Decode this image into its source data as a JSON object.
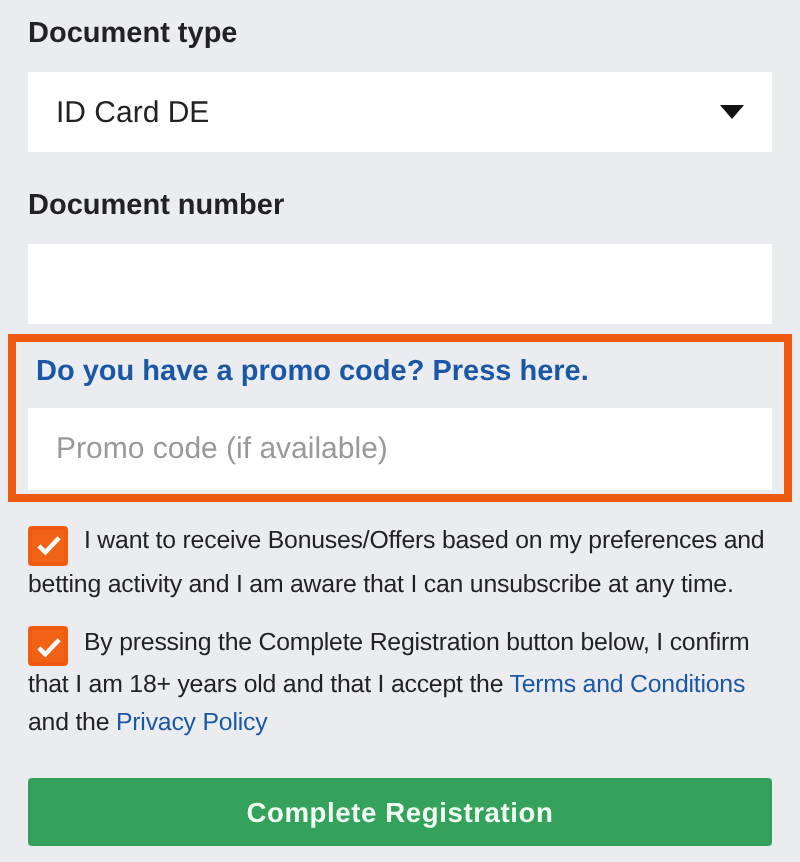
{
  "fields": [
    {
      "kind": "select",
      "label": "Document type",
      "value": "ID Card DE"
    },
    {
      "kind": "input",
      "label": "Document number"
    }
  ],
  "promo": {
    "link": "Do you have a promo code? Press here.",
    "placeholder": "Promo code (if available)",
    "highlighted": true
  },
  "consents": [
    {
      "checked": true,
      "parts": [
        {
          "kind": "text",
          "text": "I want to receive Bonuses/Offers based on my preferences and betting activity and I am aware that I can unsubscribe at any time."
        }
      ]
    },
    {
      "checked": true,
      "parts": [
        {
          "kind": "text",
          "text": "By pressing the Complete Registration button below, I confirm that I am 18+ years old and that I accept the "
        },
        {
          "kind": "link",
          "text": "Terms and Conditions"
        },
        {
          "kind": "text",
          "text": " and the "
        },
        {
          "kind": "link",
          "text": "Privacy Policy"
        }
      ]
    }
  ],
  "submit": "Complete Registration"
}
